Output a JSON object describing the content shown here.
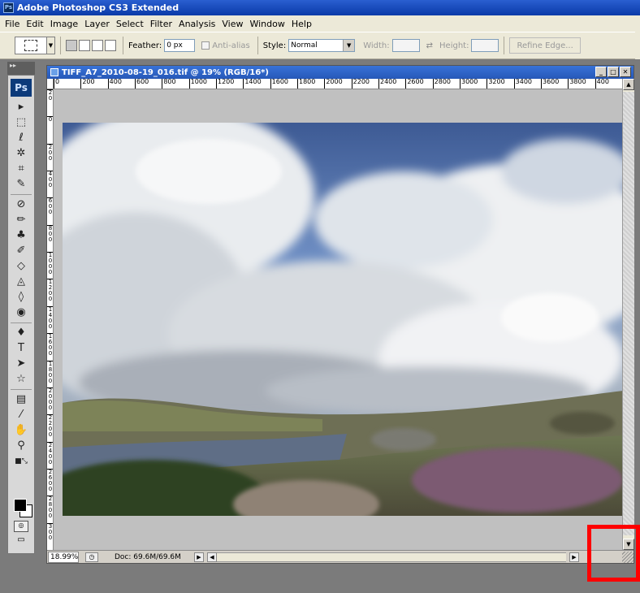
{
  "app": {
    "title": "Adobe Photoshop CS3 Extended",
    "icon_label": "Ps"
  },
  "menu": [
    "File",
    "Edit",
    "Image",
    "Layer",
    "Select",
    "Filter",
    "Analysis",
    "View",
    "Window",
    "Help"
  ],
  "options": {
    "feather_label": "Feather:",
    "feather_value": "0 px",
    "antialias_label": "Anti-alias",
    "style_label": "Style:",
    "style_value": "Normal",
    "width_label": "Width:",
    "height_label": "Height:",
    "refine_edge": "Refine Edge..."
  },
  "toolbox": {
    "logo": "Ps",
    "tools": [
      "move-tool",
      "marquee-tool",
      "lasso-tool",
      "magic-wand-tool",
      "crop-tool",
      "slice-tool",
      "healing-tool",
      "brush-tool",
      "clone-stamp-tool",
      "history-brush-tool",
      "eraser-tool",
      "paint-bucket-tool",
      "blur-tool",
      "dodge-tool",
      "pen-tool",
      "type-tool",
      "path-selection-tool",
      "shape-tool",
      "notes-tool",
      "eyedropper-tool",
      "hand-tool",
      "zoom-tool"
    ],
    "foreground_color": "#000000",
    "background_color": "#ffffff"
  },
  "document": {
    "title": "TIFF_A7_2010-08-19_016.tif @ 19% (RGB/16*)",
    "h_ruler": [
      "0",
      "200",
      "400",
      "600",
      "800",
      "1000",
      "1200",
      "1400",
      "1600",
      "1800",
      "2000",
      "2200",
      "2400",
      "2600",
      "2800",
      "3000",
      "3200",
      "3400",
      "3600",
      "3800",
      "400"
    ],
    "v_ruler": [
      "2 0",
      "0",
      "2 0 0",
      "4 0 0",
      "6 0 0",
      "8 0 0",
      "1 0 0 0",
      "1 2 0 0",
      "1 4 0 0",
      "1 6 0 0",
      "1 8 0 0",
      "2 0 0 0",
      "2 2 0 0",
      "2 4 0 0",
      "2 6 0 0",
      "2 8 0 0",
      "3 0 0"
    ],
    "zoom": "18.99%",
    "doc_info": "Doc: 69.6M/69.6M"
  },
  "colors": {
    "accent_highlight": "#ff0000",
    "title_bar": "#0a3aa8",
    "workspace": "#7b7b7b"
  }
}
